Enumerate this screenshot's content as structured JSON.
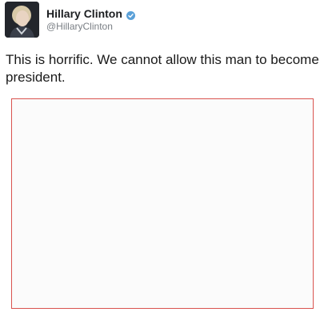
{
  "tweet": {
    "author": {
      "display_name": "Hillary Clinton",
      "handle": "@HillaryClinton",
      "verified_icon": "verified-badge-icon",
      "avatar_icon": "profile-photo"
    },
    "text": "This is horrific. We cannot allow this man to become president.",
    "media": {
      "frame_color": "#d9534f"
    }
  },
  "colors": {
    "verified": "#5aa0d8",
    "handle": "#7a7f85",
    "text": "#1a1a1a"
  }
}
